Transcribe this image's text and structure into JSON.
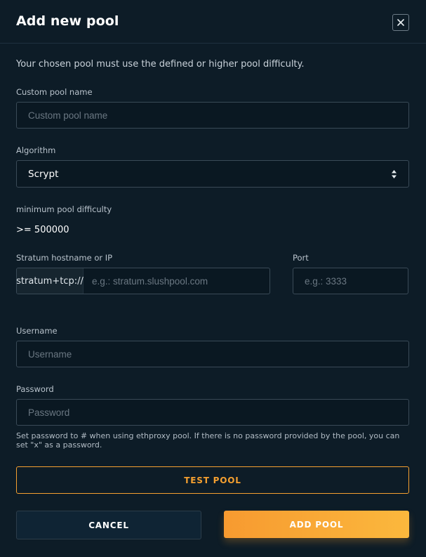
{
  "header": {
    "title": "Add new pool",
    "close_icon": "close-icon"
  },
  "notice": "Your chosen pool must use the defined or higher pool difficulty.",
  "fields": {
    "pool_name": {
      "label": "Custom pool name",
      "placeholder": "Custom pool name",
      "value": ""
    },
    "algorithm": {
      "label": "Algorithm",
      "value": "Scrypt",
      "icon": "select-arrows-icon"
    },
    "difficulty": {
      "label": "minimum pool difficulty",
      "value": ">= 500000"
    },
    "stratum": {
      "label": "Stratum hostname or IP",
      "prefix": "stratum+tcp://",
      "placeholder": "e.g.: stratum.slushpool.com",
      "value": ""
    },
    "port": {
      "label": "Port",
      "placeholder": "e.g.: 3333",
      "value": ""
    },
    "username": {
      "label": "Username",
      "placeholder": "Username",
      "value": ""
    },
    "password": {
      "label": "Password",
      "placeholder": "Password",
      "value": "",
      "hint": "Set password to # when using ethproxy pool. If there is no password provided by the pool, you can set \"x\" as a password."
    }
  },
  "buttons": {
    "test_pool": "TEST POOL",
    "cancel": "CANCEL",
    "add_pool": "ADD POOL"
  },
  "colors": {
    "accent": "#f5a030",
    "background": "#0d1c27",
    "input_border": "#3a4a57"
  }
}
